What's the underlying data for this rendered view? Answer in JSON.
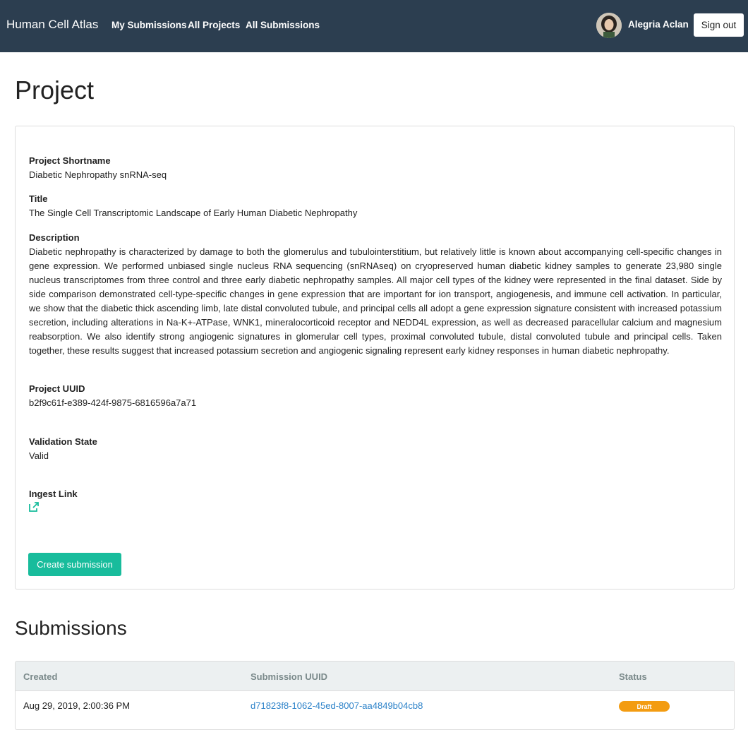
{
  "navbar": {
    "brand": "Human Cell Atlas",
    "links": [
      {
        "label": "My Submissions"
      },
      {
        "label": "All Projects"
      },
      {
        "label": "All Submissions"
      }
    ],
    "user_name": "Alegria Aclan",
    "sign_out": "Sign out",
    "bg_color": "#2c3e50"
  },
  "page_title": "Project",
  "project": {
    "shortname_label": "Project Shortname",
    "shortname": "Diabetic Nephropathy snRNA-seq",
    "title_label": "Title",
    "title": "The Single Cell Transcriptomic Landscape of Early Human Diabetic Nephropathy",
    "description_label": "Description",
    "description": "Diabetic nephropathy is characterized by damage to both the glomerulus and tubulointerstitium, but relatively little is known about accompanying cell-specific changes in gene expression. We performed unbiased single nucleus RNA sequencing (snRNAseq) on cryopreserved human diabetic kidney samples to generate 23,980 single nucleus transcriptomes from three control and three early diabetic nephropathy samples. All major cell types of the kidney were represented in the final dataset. Side by side comparison demonstrated cell-type-specific changes in gene expression that are important for ion transport, angiogenesis, and immune cell activation. In particular, we show that the diabetic thick ascending limb, late distal convoluted tubule, and principal cells all adopt a gene expression signature consistent with increased potassium secretion, including alterations in Na-K+-ATPase, WNK1, mineralocorticoid receptor and NEDD4L expression, as well as decreased paracellular calcium and magnesium reabsorption. We also identify strong angiogenic signatures in glomerular cell types, proximal convoluted tubule, distal convoluted tubule and principal cells. Taken together, these results suggest that increased potassium secretion and angiogenic signaling represent early kidney responses in human diabetic nephropathy.",
    "uuid_label": "Project UUID",
    "uuid": "b2f9c61f-e389-424f-9875-6816596a7a71",
    "validation_label": "Validation State",
    "validation_state": "Valid",
    "ingest_link_label": "Ingest Link",
    "ingest_link_icon": "external-link-icon",
    "create_submission": "Create submission",
    "accent_color": "#18bc9c"
  },
  "submissions": {
    "title": "Submissions",
    "columns": [
      "Created",
      "Submission UUID",
      "Status"
    ],
    "rows": [
      {
        "created": "Aug 29, 2019, 2:00:36 PM",
        "uuid": "d71823f8-1062-45ed-8007-aa4849b04cb8",
        "status": "Draft",
        "status_color": "#f39c12"
      }
    ]
  }
}
